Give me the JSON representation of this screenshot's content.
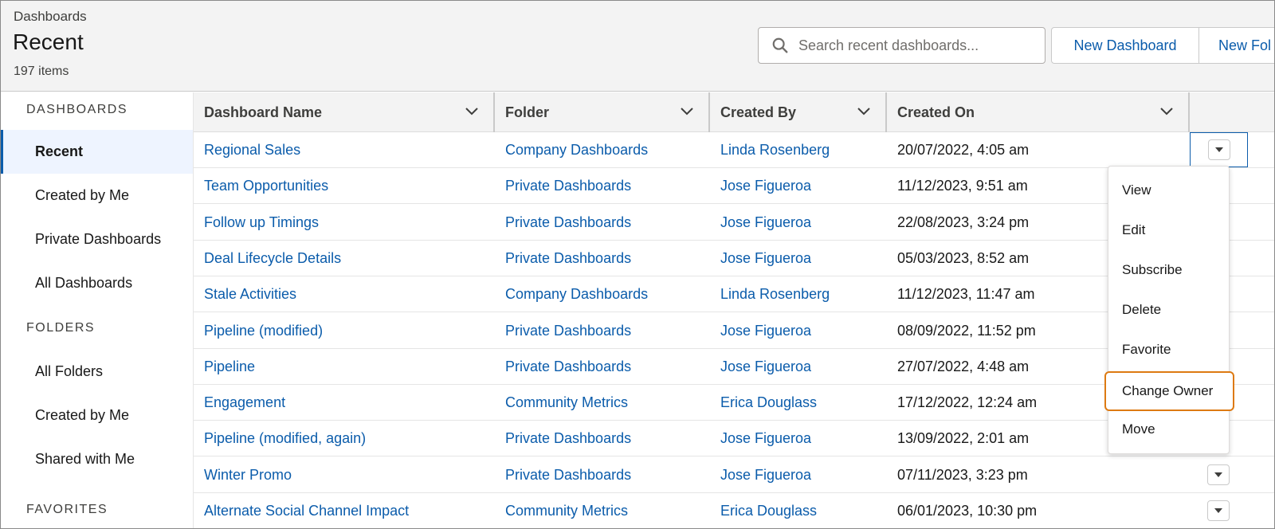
{
  "header": {
    "breadcrumb": "Dashboards",
    "title": "Recent",
    "item_count": "197 items",
    "search_placeholder": "Search recent dashboards...",
    "new_dashboard_label": "New Dashboard",
    "new_folder_label": "New Fol"
  },
  "sidebar": {
    "dashboards_heading": "DASHBOARDS",
    "dashboards_items": [
      "Recent",
      "Created by Me",
      "Private Dashboards",
      "All Dashboards"
    ],
    "folders_heading": "FOLDERS",
    "folders_items": [
      "All Folders",
      "Created by Me",
      "Shared with Me"
    ],
    "favorites_heading": "FAVORITES",
    "active_item": "Recent"
  },
  "table": {
    "columns": [
      "Dashboard Name",
      "Folder",
      "Created By",
      "Created On"
    ],
    "rows": [
      {
        "name": "Regional Sales",
        "folder": "Company Dashboards",
        "created_by": "Linda Rosenberg",
        "created_on": "20/07/2022, 4:05 am"
      },
      {
        "name": "Team Opportunities",
        "folder": "Private Dashboards",
        "created_by": "Jose Figueroa",
        "created_on": "11/12/2023, 9:51 am"
      },
      {
        "name": "Follow up Timings",
        "folder": "Private Dashboards",
        "created_by": "Jose Figueroa",
        "created_on": "22/08/2023, 3:24 pm"
      },
      {
        "name": "Deal Lifecycle Details",
        "folder": "Private Dashboards",
        "created_by": "Jose Figueroa",
        "created_on": "05/03/2023, 8:52 am"
      },
      {
        "name": "Stale Activities",
        "folder": "Company Dashboards",
        "created_by": "Linda Rosenberg",
        "created_on": "11/12/2023, 11:47 am"
      },
      {
        "name": "Pipeline (modified)",
        "folder": "Private Dashboards",
        "created_by": "Jose Figueroa",
        "created_on": "08/09/2022, 11:52 pm"
      },
      {
        "name": "Pipeline",
        "folder": "Private Dashboards",
        "created_by": "Jose Figueroa",
        "created_on": "27/07/2022, 4:48 am"
      },
      {
        "name": "Engagement",
        "folder": "Community Metrics",
        "created_by": "Erica Douglass",
        "created_on": "17/12/2022, 12:24 am"
      },
      {
        "name": "Pipeline (modified, again)",
        "folder": "Private Dashboards",
        "created_by": "Jose Figueroa",
        "created_on": "13/09/2022, 2:01 am"
      },
      {
        "name": "Winter Promo",
        "folder": "Private Dashboards",
        "created_by": "Jose Figueroa",
        "created_on": "07/11/2023, 3:23 pm"
      },
      {
        "name": "Alternate Social Channel Impact",
        "folder": "Community Metrics",
        "created_by": "Erica Douglass",
        "created_on": "06/01/2023, 10:30 pm"
      }
    ]
  },
  "row_menu": {
    "items": [
      "View",
      "Edit",
      "Subscribe",
      "Delete",
      "Favorite",
      "Change Owner",
      "Move"
    ],
    "highlighted_item": "Change Owner"
  },
  "colors": {
    "link": "#0b5cab",
    "highlight_border": "#dd7a12",
    "active_nav_bg": "#eef4ff"
  }
}
